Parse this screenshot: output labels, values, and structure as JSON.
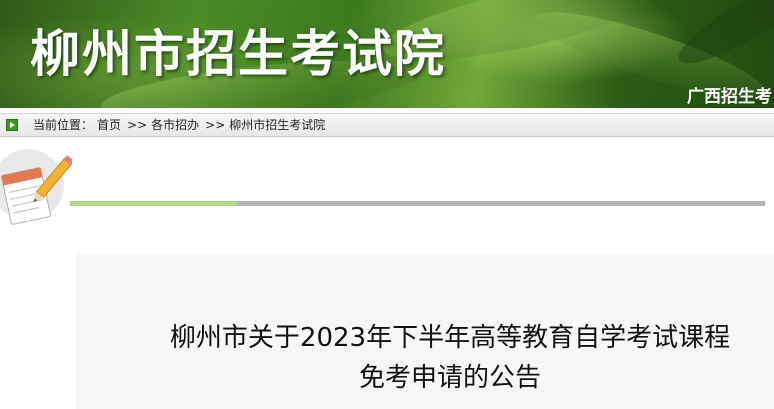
{
  "header": {
    "title": "柳州市招生考试院",
    "subtitle": "广西招生考"
  },
  "breadcrumb": {
    "prefix": "当前位置：",
    "items": [
      "首页",
      "各市招办",
      "柳州市招生考试院"
    ],
    "separator": ">>"
  },
  "progress": {
    "fraction": 0.24
  },
  "article": {
    "title_line1": "柳州市关于2023年下半年高等教育自学考试课程",
    "title_line2": "免考申请的公告"
  },
  "colors": {
    "banner_green": "#4c8a27",
    "progress_fill": "#b3d88a",
    "progress_track": "#b4b4b4"
  },
  "icons": {
    "breadcrumb": "green-arrow-icon",
    "note": "notepad-pencil-icon"
  }
}
